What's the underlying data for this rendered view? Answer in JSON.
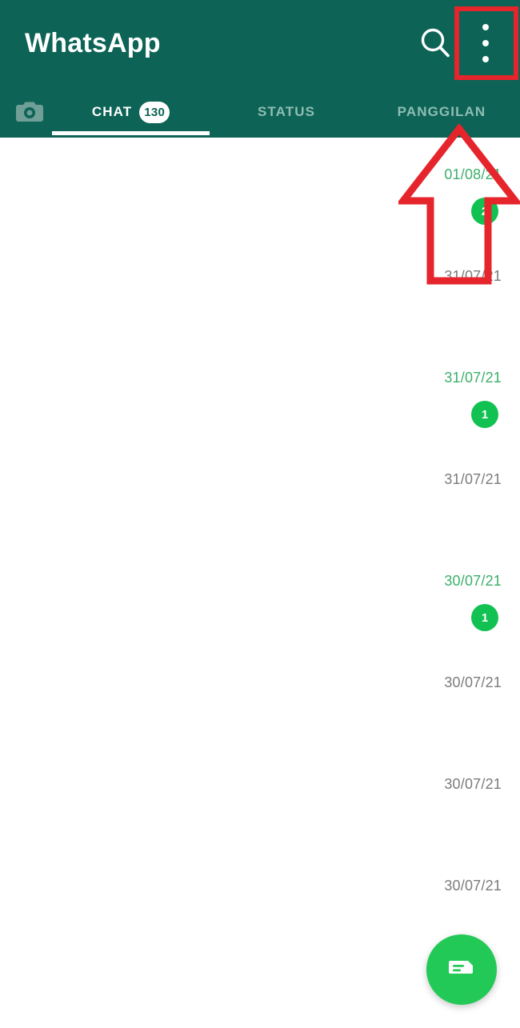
{
  "app": {
    "title": "WhatsApp"
  },
  "appbar": {
    "search_icon": "search-icon",
    "overflow_icon": "overflow-menu-icon"
  },
  "tabs": [
    {
      "key": "camera",
      "label": "",
      "icon": "camera-icon",
      "active": false
    },
    {
      "key": "chat",
      "label": "CHAT",
      "badge": "130",
      "active": true
    },
    {
      "key": "status",
      "label": "STATUS",
      "badge": "",
      "active": false
    },
    {
      "key": "calls",
      "label": "PANGGILAN",
      "badge": "",
      "active": false
    }
  ],
  "chat_list": {
    "rows": [
      {
        "date": "01/08/21",
        "unread": true,
        "badge": "2"
      },
      {
        "date": "31/07/21",
        "unread": false,
        "badge": ""
      },
      {
        "date": "31/07/21",
        "unread": true,
        "badge": "1"
      },
      {
        "date": "31/07/21",
        "unread": false,
        "badge": ""
      },
      {
        "date": "30/07/21",
        "unread": true,
        "badge": "1"
      },
      {
        "date": "30/07/21",
        "unread": false,
        "badge": ""
      },
      {
        "date": "30/07/21",
        "unread": false,
        "badge": ""
      },
      {
        "date": "30/07/21",
        "unread": false,
        "badge": ""
      }
    ]
  },
  "fab": {
    "icon": "new-chat-icon",
    "color": "#23c957"
  },
  "annotations": {
    "color": "#e5242b",
    "highlight_rect_target": "overflow-menu-icon",
    "arrow_target": "overflow-menu-icon"
  },
  "colors": {
    "header": "#0d6356",
    "accent_green": "#11c152",
    "unread_date": "#3caf6a",
    "read_date": "#7b7b7b",
    "annotation_red": "#e5242b"
  }
}
